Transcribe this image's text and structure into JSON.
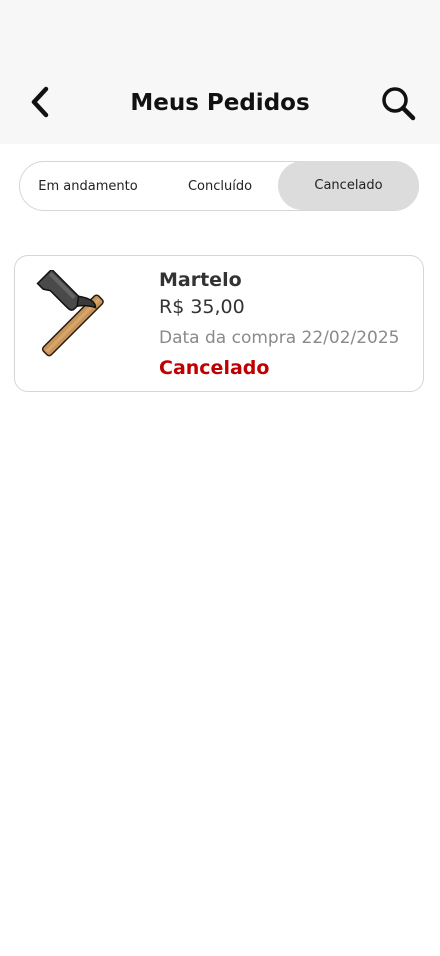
{
  "header": {
    "title": "Meus Pedidos",
    "back_icon": "chevron-left-icon",
    "search_icon": "search-icon"
  },
  "tabs": [
    {
      "label": "Em andamento",
      "active": false
    },
    {
      "label": "Concluído",
      "active": false
    },
    {
      "label": "Cancelado",
      "active": true
    }
  ],
  "orders": [
    {
      "name": "Martelo",
      "price": "R$ 35,00",
      "date": "Data da compra 22/02/2025",
      "status": "Cancelado",
      "icon": "hammer-icon"
    }
  ],
  "colors": {
    "header_bg": "#f7f7f7",
    "active_tab_bg": "#dcdcdc",
    "status_cancelled": "#c00000"
  }
}
